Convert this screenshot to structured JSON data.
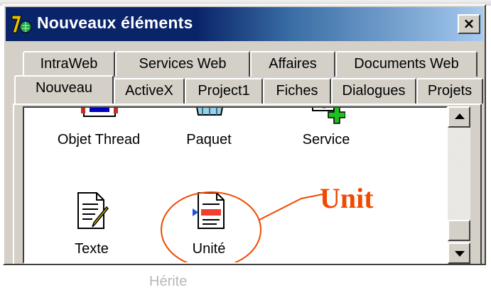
{
  "window": {
    "title": "Nouveaux éléments",
    "close_label": "×"
  },
  "tabs": {
    "back_row": [
      "IntraWeb",
      "Services Web",
      "Affaires",
      "Documents Web"
    ],
    "front_row": [
      "Nouveau",
      "ActiveX",
      "Project1",
      "Fiches",
      "Dialogues",
      "Projets"
    ],
    "active": "Nouveau"
  },
  "items": [
    {
      "label": "Objet Thread",
      "icon": "thread-object-icon"
    },
    {
      "label": "Paquet",
      "icon": "package-icon"
    },
    {
      "label": "Service",
      "icon": "service-icon"
    },
    {
      "label": "Texte",
      "icon": "text-file-icon"
    },
    {
      "label": "Unité",
      "icon": "unit-file-icon",
      "highlighted": true
    }
  ],
  "annotation": {
    "text": "Unit",
    "color": "#f04a00"
  },
  "footer": {
    "partial_text": "Hérite"
  },
  "colors": {
    "titlebar_start": "#0a246a",
    "titlebar_end": "#a6caf0",
    "face": "#d4d0c8",
    "annotation": "#f04a00"
  }
}
